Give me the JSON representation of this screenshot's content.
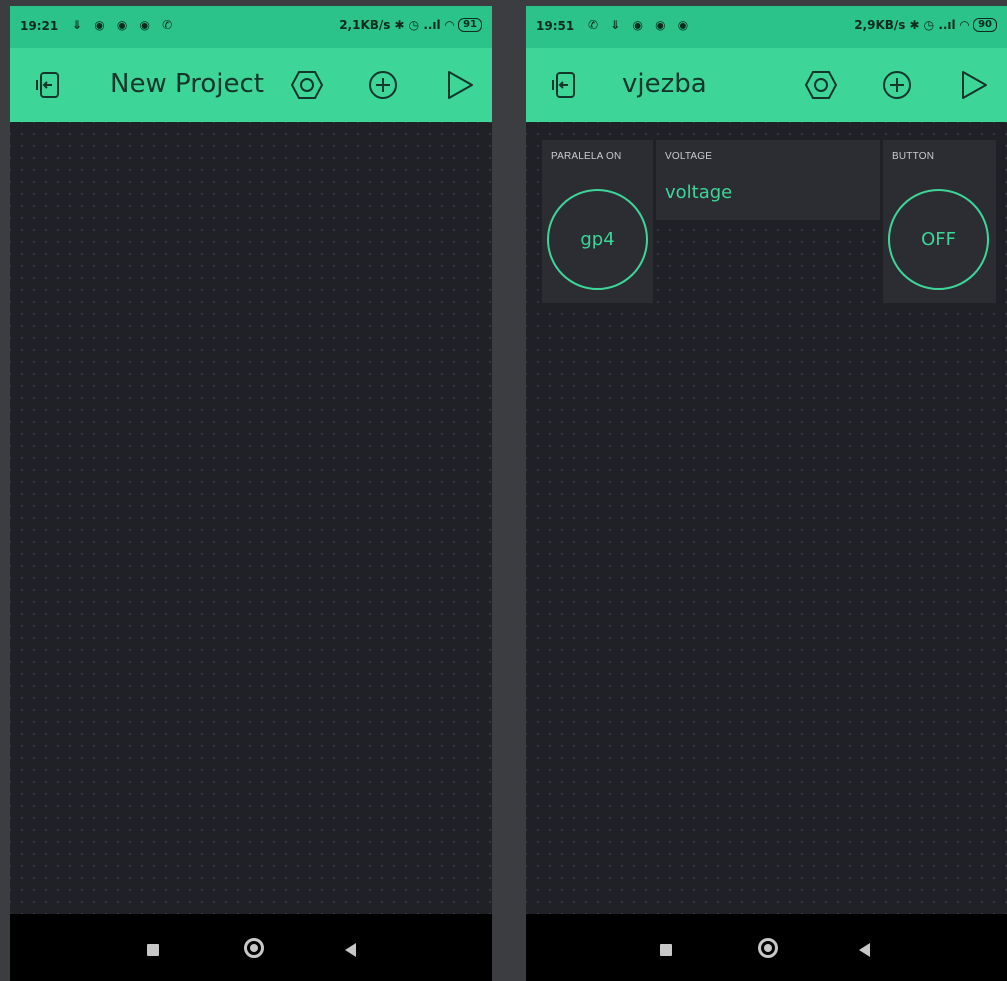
{
  "colors": {
    "accent": "#3ed598",
    "status_bar": "#2cc38a",
    "background": "#202127",
    "widget": "#2c2d33"
  },
  "icons": [
    "project-exit-icon",
    "settings-hexagon-icon",
    "add-widget-icon",
    "play-icon"
  ],
  "left": {
    "status": {
      "time": "19:21",
      "left_icons": "⇓ ◉ ◉ ◉ ✆",
      "speed": "2,1KB/s",
      "extra_icons": "✱ ◷ ..ıl ◠",
      "battery": "91"
    },
    "app_bar": {
      "title": "New Project"
    }
  },
  "right": {
    "status": {
      "time": "19:51",
      "left_icons": "✆ ⇓ ◉ ◉ ◉",
      "speed": "2,9KB/s",
      "extra_icons": "✱ ◷ ..ıl ◠",
      "battery": "90"
    },
    "app_bar": {
      "title": "vjezba"
    },
    "widgets": {
      "paralela": {
        "label": "PARALELA ON",
        "button_text": "gp4"
      },
      "voltage": {
        "label": "VOLTAGE",
        "value": "voltage"
      },
      "button": {
        "label": "BUTTON",
        "button_text": "OFF"
      }
    }
  }
}
